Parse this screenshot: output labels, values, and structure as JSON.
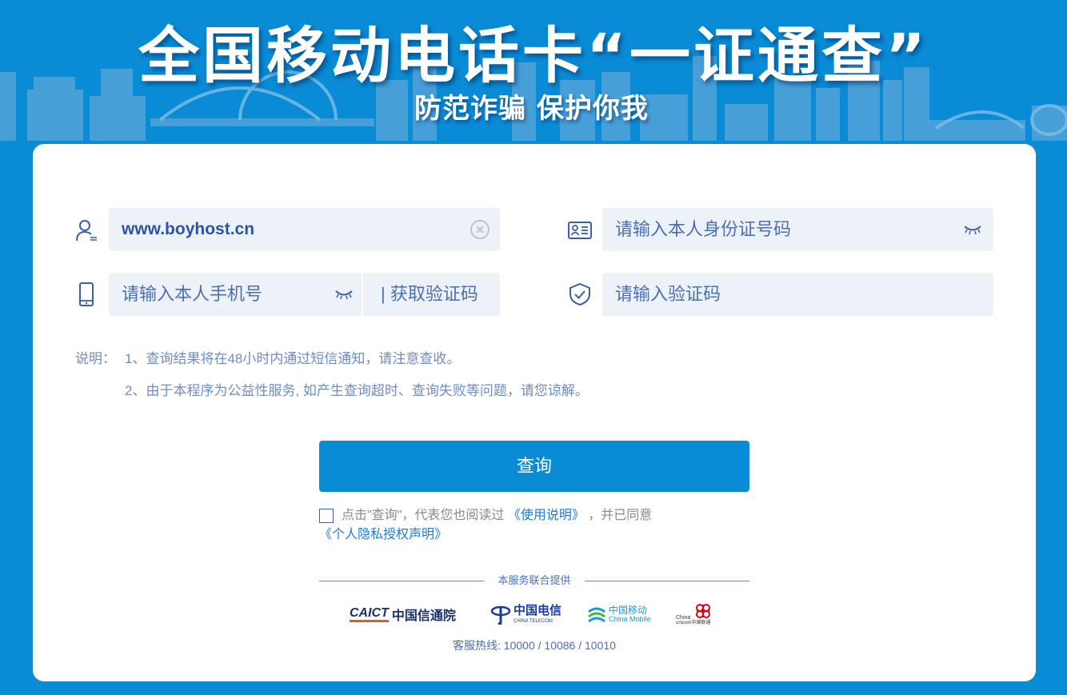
{
  "banner": {
    "title": "全国移动电话卡“一证通查”",
    "subtitle": "防范诈骗 保护你我"
  },
  "form": {
    "name_field": {
      "value": "www.boyhost.cn",
      "icon": "user-icon",
      "clear_icon": "clear-circle-icon"
    },
    "id_field": {
      "placeholder": "请输入本人身份证号码",
      "icon": "id-card-icon",
      "toggle_icon": "eye-closed-icon"
    },
    "phone_field": {
      "placeholder": "请输入本人手机号",
      "icon": "phone-icon",
      "toggle_icon": "eye-closed-icon"
    },
    "sms_button": "|  获取验证码",
    "code_field": {
      "placeholder": "请输入验证码",
      "icon": "shield-check-icon"
    }
  },
  "notes": {
    "label": "说明：",
    "items": [
      "1、查询结果将在48小时内通过短信通知，请注意查收。",
      "2、由于本程序为公益性服务, 如产生查询超时、查询失败等问题，请您谅解。"
    ]
  },
  "query_button": "查询",
  "agreement": {
    "checked": false,
    "prefix": "点击\"查询\"，代表您也阅读过",
    "link1": "《使用说明》",
    "middle": "，并已同意",
    "link2": "《个人隐私授权声明》"
  },
  "provider": {
    "label": "本服务联合提供",
    "logos": {
      "caict_en": "CAICT",
      "caict_cn": "中国信通院",
      "telecom_cn": "中国电信",
      "telecom_en": "CHINA TELECOM",
      "mobile_cn": "中国移动",
      "mobile_en": "China Mobile",
      "unicom_en1": "China",
      "unicom_en2": "unicom中国联通"
    }
  },
  "hotline": "客服热线: 10000 / 10086 / 10010",
  "colors": {
    "background": "#0a8bd6",
    "field": "#edf2f9",
    "text_blue": "#4a6fb5",
    "link": "#1e7ad4"
  }
}
